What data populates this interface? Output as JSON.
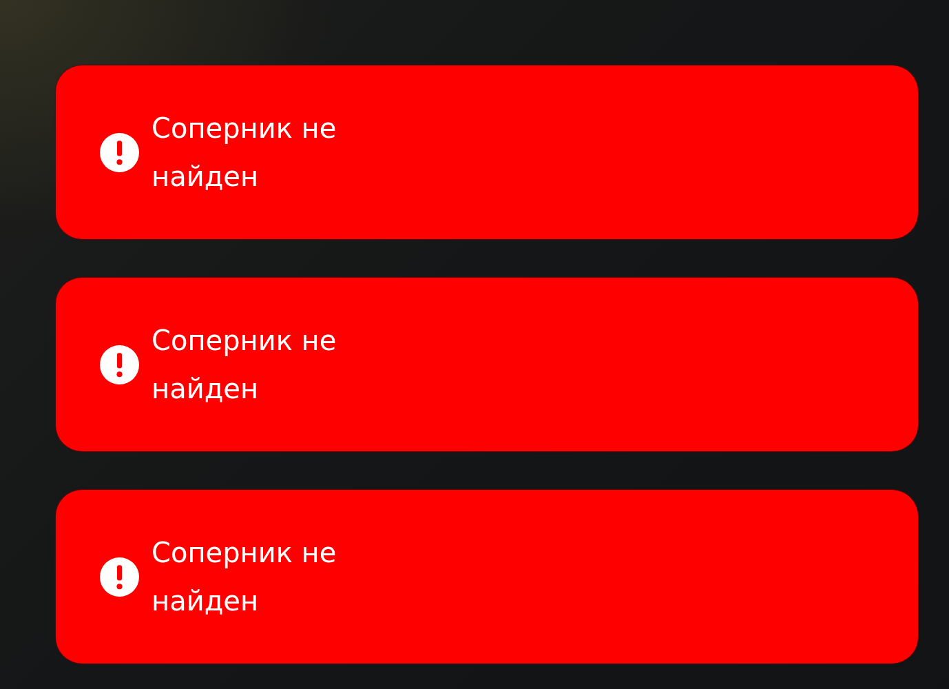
{
  "notifications": [
    {
      "message": "Соперник не найден"
    },
    {
      "message": "Соперник не найден"
    },
    {
      "message": "Соперник не найден"
    }
  ]
}
